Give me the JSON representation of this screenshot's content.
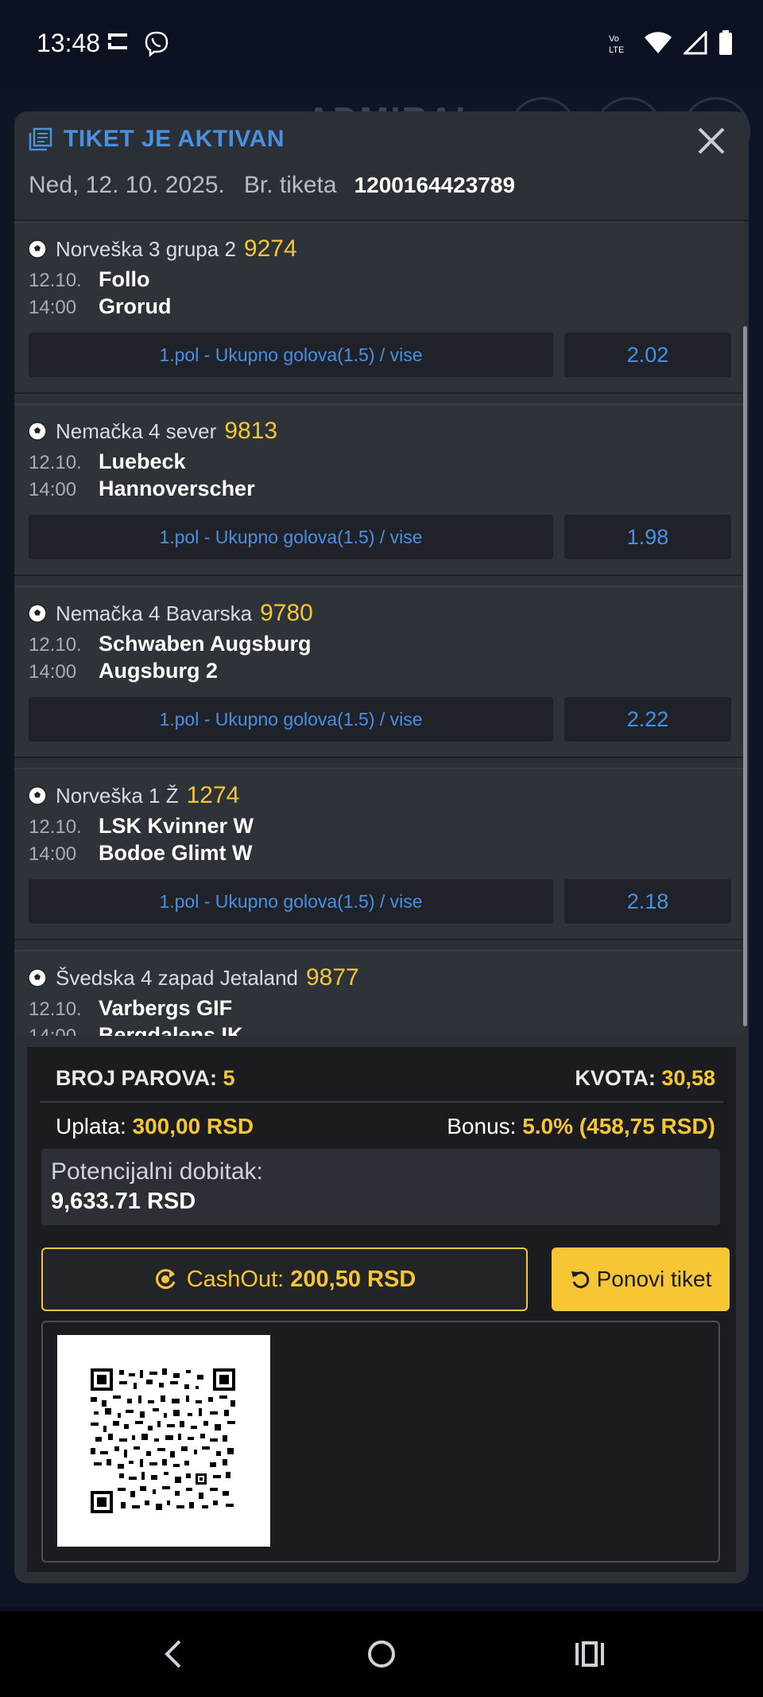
{
  "status_bar": {
    "time": "13:48",
    "network": "Vo LTE"
  },
  "app_background": {
    "brand": "ADMIRAL"
  },
  "modal": {
    "title": "TIKET JE AKTIVAN",
    "date": "Ned, 12. 10. 2025.",
    "ticket_label": "Br. tiketa",
    "ticket_number": "1200164423789"
  },
  "matches": [
    {
      "league": "Norveška 3 grupa 2",
      "code": "9274",
      "date": "12.10.",
      "time": "14:00",
      "home": "Follo",
      "away": "Grorud",
      "bet": "1.pol - Ukupno golova(1.5) / vise",
      "odd": "2.02"
    },
    {
      "league": "Nemačka 4 sever",
      "code": "9813",
      "date": "12.10.",
      "time": "14:00",
      "home": "Luebeck",
      "away": "Hannoverscher",
      "bet": "1.pol - Ukupno golova(1.5) / vise",
      "odd": "1.98"
    },
    {
      "league": "Nemačka 4 Bavarska",
      "code": "9780",
      "date": "12.10.",
      "time": "14:00",
      "home": "Schwaben Augsburg",
      "away": "Augsburg 2",
      "bet": "1.pol - Ukupno golova(1.5) / vise",
      "odd": "2.22"
    },
    {
      "league": "Norveška 1 Ž",
      "code": "1274",
      "date": "12.10.",
      "time": "14:00",
      "home": "LSK Kvinner W",
      "away": "Bodoe Glimt W",
      "bet": "1.pol - Ukupno golova(1.5) / vise",
      "odd": "2.18"
    },
    {
      "league": "Švedska 4 zapad Jetaland",
      "code": "9877",
      "date": "12.10.",
      "time": "14:00",
      "home": "Varbergs GIF",
      "away": "Bergdalens IK",
      "bet": "",
      "odd": ""
    }
  ],
  "summary": {
    "pairs_label": "BROJ PAROVA:",
    "pairs_value": "5",
    "odds_label": "KVOTA:",
    "odds_value": "30,58",
    "stake_label": "Uplata:",
    "stake_value": "300,00 RSD",
    "bonus_label": "Bonus:",
    "bonus_value": "5.0% (458,75 RSD)",
    "potential_label": "Potencijalni dobitak:",
    "potential_value": "9,633.71 RSD",
    "cashout_label": "CashOut:",
    "cashout_value": "200,50 RSD",
    "repeat_label": "Ponovi tiket"
  },
  "colors": {
    "accent_blue": "#4a90e2",
    "accent_yellow": "#f6c634",
    "panel": "#2b2f36"
  }
}
